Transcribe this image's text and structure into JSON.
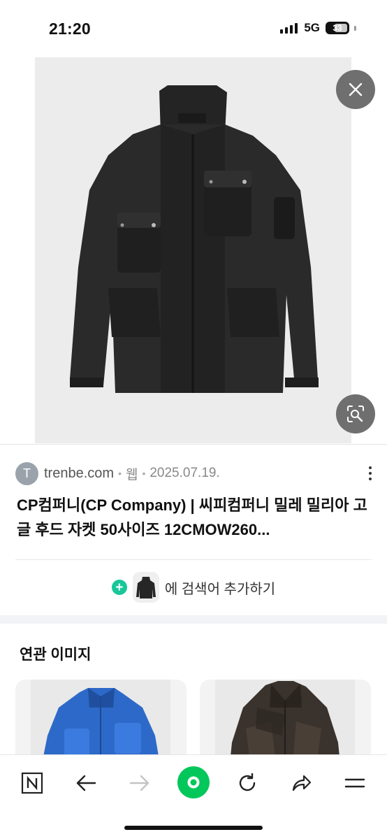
{
  "status_bar": {
    "time": "21:20",
    "network": "5G",
    "battery": "33"
  },
  "result": {
    "favicon_letter": "T",
    "domain": "trenbe.com",
    "type": "웹",
    "date": "2025.07.19.",
    "title": "CP컴퍼니(CP Company) | 씨피컴퍼니 밀레 밀리아 고글 후드 자켓 50사이즈 12CMOW260..."
  },
  "add_search": {
    "label": "에 검색어 추가하기"
  },
  "related": {
    "heading": "연관 이미지"
  },
  "colors": {
    "accent_green": "#16c79a",
    "naver_green": "#03c75a",
    "overlay_gray": "#6f6f6f"
  }
}
